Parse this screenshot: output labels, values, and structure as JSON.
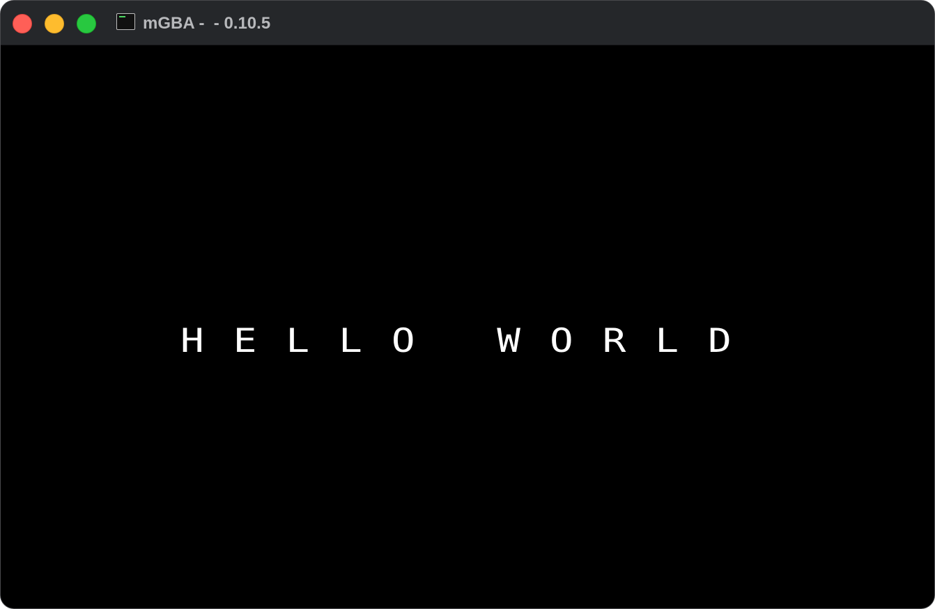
{
  "window": {
    "title": "mGBA -  - 0.10.5",
    "app_icon": "terminal-icon",
    "traffic_lights": {
      "close_color": "#ff5f57",
      "minimize_color": "#febc2e",
      "zoom_color": "#28c840"
    }
  },
  "game_screen": {
    "text": "HELLO WORLD",
    "text_color": "#ffffff",
    "background_color": "#000000"
  }
}
